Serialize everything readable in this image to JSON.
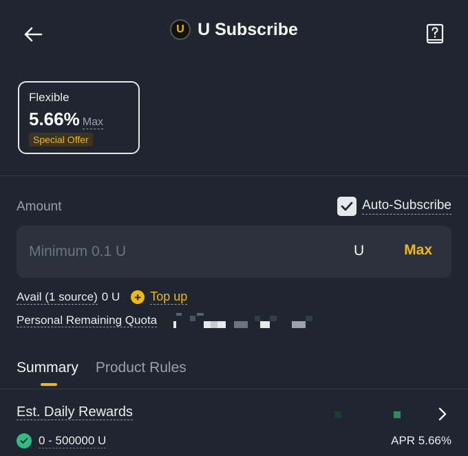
{
  "header": {
    "title": "U Subscribe",
    "coin_letter": "U",
    "back_icon": "arrow-left-icon",
    "guide_icon": "book-question-icon"
  },
  "offer_card": {
    "label": "Flexible",
    "rate": "5.66%",
    "rate_suffix": "Max",
    "badge": "Special Offer"
  },
  "amount": {
    "label": "Amount",
    "auto_subscribe_label": "Auto-Subscribe",
    "auto_subscribe_checked": true,
    "placeholder": "Minimum 0.1 U",
    "unit": "U",
    "max_label": "Max"
  },
  "availability": {
    "avail_label": "Avail (1 source)",
    "avail_value": "0 U",
    "topup_label": "Top up",
    "quota_label": "Personal Remaining Quota"
  },
  "tabs": [
    {
      "label": "Summary",
      "active": true
    },
    {
      "label": "Product Rules",
      "active": false
    }
  ],
  "rewards": {
    "label": "Est. Daily Rewards",
    "tier_range": "0 - 500000 U",
    "tier_apr": "APR 5.66%"
  },
  "colors": {
    "background": "#1f2630",
    "accent": "#f0b90b",
    "success": "#2ebd85",
    "muted": "#9aa1ab"
  }
}
